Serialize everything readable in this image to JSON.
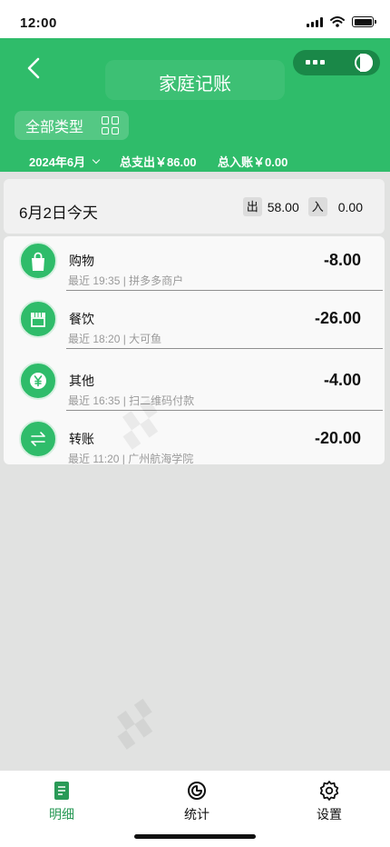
{
  "status_bar": {
    "time": "12:00"
  },
  "header": {
    "title": "家庭记账",
    "type_filter": "全部类型",
    "month": "2024年6月",
    "total_expense": "总支出￥86.00",
    "total_income": "总入账￥0.00"
  },
  "day": {
    "label": "6月2日今天",
    "out_tag": "出",
    "out_value": "58.00",
    "in_tag": "入",
    "in_value": "0.00"
  },
  "transactions": [
    {
      "name": "购物",
      "meta": "最近 19:35 | 拼多多商户",
      "amount": "-8.00",
      "icon": "shopping-bag-icon"
    },
    {
      "name": "餐饮",
      "meta": "最近 18:20 | 大可鱼",
      "amount": "-26.00",
      "icon": "storefront-icon"
    },
    {
      "name": "其他",
      "meta": "最近 16:35 | 扫二维码付款",
      "amount": "-4.00",
      "icon": "yuan-coin-icon"
    },
    {
      "name": "转账",
      "meta": "最近 11:20 | 广州航海学院",
      "amount": "-20.00",
      "icon": "transfer-icon"
    }
  ],
  "tabbar": {
    "tabs": [
      {
        "label": "明细",
        "icon": "ledger-icon",
        "active": true
      },
      {
        "label": "统计",
        "icon": "stats-icon",
        "active": false
      },
      {
        "label": "设置",
        "icon": "gear-icon",
        "active": false
      }
    ]
  },
  "colors": {
    "brand": "#2fbc6a",
    "brand_dark": "#1a8848",
    "active_tab": "#2a9a57"
  }
}
